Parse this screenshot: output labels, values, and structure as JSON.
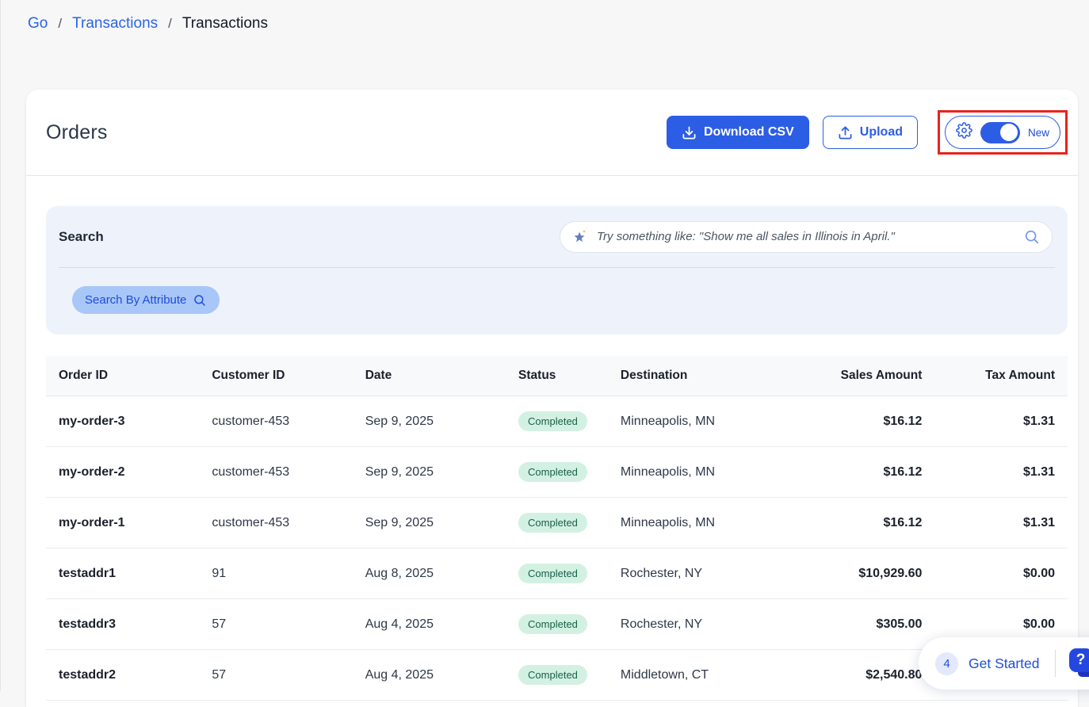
{
  "breadcrumb": {
    "separator": "/",
    "items": [
      {
        "label": "Go"
      },
      {
        "label": "Transactions"
      },
      {
        "label": "Transactions"
      }
    ]
  },
  "header": {
    "title": "Orders",
    "download_button": "Download CSV",
    "upload_button": "Upload",
    "new_badge": "New"
  },
  "search": {
    "title": "Search",
    "placeholder": "Try something like: \"Show me all sales in Illinois in April.\"",
    "attribute_button": "Search By Attribute"
  },
  "table": {
    "columns": [
      "Order ID",
      "Customer ID",
      "Date",
      "Status",
      "Destination",
      "Sales Amount",
      "Tax Amount"
    ],
    "rows": [
      {
        "order_id": "my-order-3",
        "customer_id": "customer-453",
        "date": "Sep 9, 2025",
        "status": "Completed",
        "destination": "Minneapolis, MN",
        "sales_amount": "$16.12",
        "tax_amount": "$1.31"
      },
      {
        "order_id": "my-order-2",
        "customer_id": "customer-453",
        "date": "Sep 9, 2025",
        "status": "Completed",
        "destination": "Minneapolis, MN",
        "sales_amount": "$16.12",
        "tax_amount": "$1.31"
      },
      {
        "order_id": "my-order-1",
        "customer_id": "customer-453",
        "date": "Sep 9, 2025",
        "status": "Completed",
        "destination": "Minneapolis, MN",
        "sales_amount": "$16.12",
        "tax_amount": "$1.31"
      },
      {
        "order_id": "testaddr1",
        "customer_id": "91",
        "date": "Aug 8, 2025",
        "status": "Completed",
        "destination": "Rochester, NY",
        "sales_amount": "$10,929.60",
        "tax_amount": "$0.00"
      },
      {
        "order_id": "testaddr3",
        "customer_id": "57",
        "date": "Aug 4, 2025",
        "status": "Completed",
        "destination": "Rochester, NY",
        "sales_amount": "$305.00",
        "tax_amount": "$0.00"
      },
      {
        "order_id": "testaddr2",
        "customer_id": "57",
        "date": "Aug 4, 2025",
        "status": "Completed",
        "destination": "Middletown, CT",
        "sales_amount": "$2,540.80",
        "tax_amount": ""
      }
    ]
  },
  "assistant": {
    "count": "4",
    "label": "Get Started"
  },
  "colors": {
    "primary_blue": "#2c5de5",
    "link_blue": "#2b63e8",
    "highlight_red": "#e8231c",
    "badge_green_bg": "#d3f1e2",
    "badge_green_text": "#186049",
    "search_panel_bg": "#eef3fb",
    "attribute_pill_bg": "#a9c6f8"
  }
}
